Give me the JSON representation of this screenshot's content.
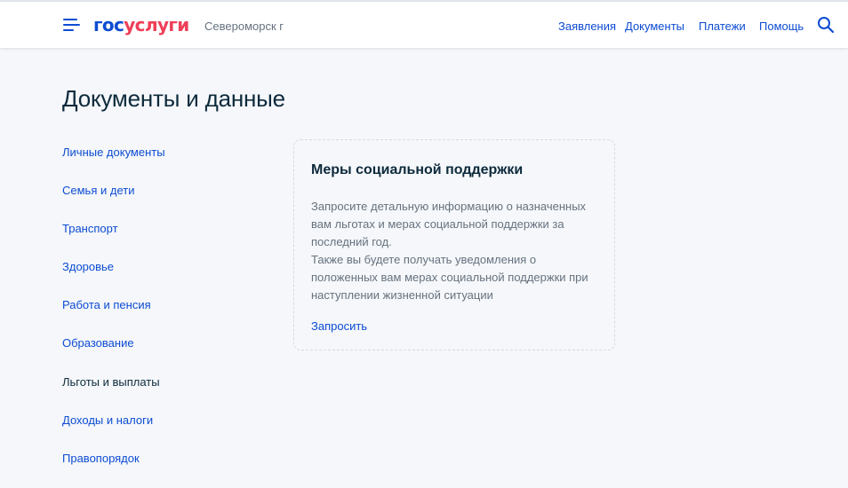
{
  "header": {
    "logo_part1": "гос",
    "logo_part2": "услуги",
    "city": "Североморск г",
    "nav": [
      {
        "label": "Заявления"
      },
      {
        "label": "Документы"
      },
      {
        "label": "Платежи"
      },
      {
        "label": "Помощь"
      }
    ]
  },
  "page": {
    "title": "Документы и данные"
  },
  "sidebar": {
    "items": [
      {
        "label": "Личные документы"
      },
      {
        "label": "Семья и дети"
      },
      {
        "label": "Транспорт"
      },
      {
        "label": "Здоровье"
      },
      {
        "label": "Работа и пенсия"
      },
      {
        "label": "Образование"
      },
      {
        "label": "Льготы и выплаты"
      },
      {
        "label": "Доходы и налоги"
      },
      {
        "label": "Правопорядок"
      }
    ]
  },
  "card": {
    "title": "Меры социальной поддержки",
    "text1": "Запросите детальную информацию о назначенных вам льготах и мерах социальной поддержки за последний год.",
    "text2": "Также вы будете получать уведомления о положенных вам мерах социальной поддержки при наступлении жизненной ситуации",
    "link": "Запросить"
  },
  "colors": {
    "accent": "#0d4cd3",
    "logo_red": "#ee3f58",
    "text": "#0d2a3c",
    "muted": "#66727f",
    "background": "#f5f7fa"
  },
  "icons": {
    "menu": "menu-icon",
    "search": "search-icon"
  }
}
